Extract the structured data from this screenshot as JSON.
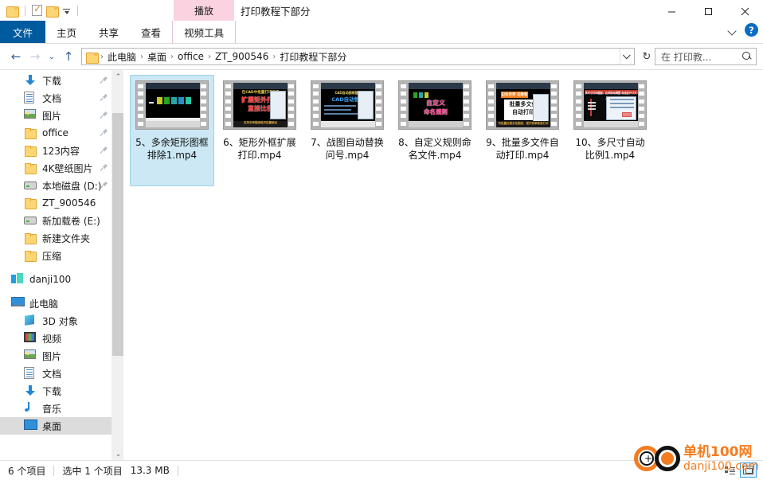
{
  "window": {
    "title": "打印教程下部分",
    "quick_access": [
      {
        "name": "folder-icon",
        "label": ""
      },
      {
        "name": "properties-icon",
        "label": ""
      },
      {
        "name": "new-folder-icon",
        "label": ""
      }
    ],
    "controls": {
      "minimize": "minimize-icon",
      "maximize": "maximize-icon",
      "close": "close-icon"
    }
  },
  "ribbon": {
    "contextual_group": "视频工具",
    "contextual_tab": "播放",
    "tabs": [
      {
        "label": "文件",
        "active": true
      },
      {
        "label": "主页",
        "active": false
      },
      {
        "label": "共享",
        "active": false
      },
      {
        "label": "查看",
        "active": false
      }
    ],
    "collapse_icon": "chevron-down-icon",
    "help_label": "?"
  },
  "address": {
    "back_icon": "back-arrow-icon",
    "forward_icon": "forward-arrow-icon",
    "recent_icon": "recent-locations-icon",
    "up_icon": "up-arrow-icon",
    "crumbs": [
      "此电脑",
      "桌面",
      "office",
      "ZT_900546",
      "打印教程下部分"
    ],
    "separator": "›",
    "dropdown_icon": "chevron-down-icon",
    "refresh_icon": "refresh-icon",
    "refresh_glyph": "↻"
  },
  "search": {
    "placeholder": "在 打印教...",
    "icon": "search-icon"
  },
  "sidebar": {
    "items": [
      {
        "label": "下载",
        "icon": "download-icon",
        "pinned": true,
        "indent": 1,
        "selected": false
      },
      {
        "label": "文档",
        "icon": "document-icon",
        "pinned": true,
        "indent": 1,
        "selected": false
      },
      {
        "label": "图片",
        "icon": "pictures-icon",
        "pinned": true,
        "indent": 1,
        "selected": false
      },
      {
        "label": "office",
        "icon": "folder-icon",
        "pinned": true,
        "indent": 1,
        "selected": false
      },
      {
        "label": "123内容",
        "icon": "folder-icon",
        "pinned": true,
        "indent": 1,
        "selected": false
      },
      {
        "label": "4K壁纸图片",
        "icon": "folder-icon",
        "pinned": true,
        "indent": 1,
        "selected": false
      },
      {
        "label": "本地磁盘 (D:)",
        "icon": "drive-icon",
        "pinned": true,
        "indent": 1,
        "selected": false
      },
      {
        "label": "ZT_900546",
        "icon": "folder-icon",
        "pinned": false,
        "indent": 1,
        "selected": false
      },
      {
        "label": "新加载卷 (E:)",
        "icon": "drive-icon",
        "pinned": false,
        "indent": 1,
        "selected": false
      },
      {
        "label": "新建文件夹",
        "icon": "folder-icon",
        "pinned": false,
        "indent": 1,
        "selected": false
      },
      {
        "label": "压缩",
        "icon": "folder-icon",
        "pinned": false,
        "indent": 1,
        "selected": false
      },
      {
        "label": "danji100",
        "icon": "cloud-icon",
        "pinned": false,
        "indent": 0,
        "selected": false,
        "gap_before": true
      },
      {
        "label": "此电脑",
        "icon": "this-pc-icon",
        "pinned": false,
        "indent": 0,
        "selected": false,
        "gap_before": true
      },
      {
        "label": "3D 对象",
        "icon": "3d-objects-icon",
        "pinned": false,
        "indent": 1,
        "selected": false
      },
      {
        "label": "视频",
        "icon": "videos-icon",
        "pinned": false,
        "indent": 1,
        "selected": false
      },
      {
        "label": "图片",
        "icon": "pictures-icon",
        "pinned": false,
        "indent": 1,
        "selected": false
      },
      {
        "label": "文档",
        "icon": "document-icon",
        "pinned": false,
        "indent": 1,
        "selected": false
      },
      {
        "label": "下载",
        "icon": "download-icon",
        "pinned": false,
        "indent": 1,
        "selected": false
      },
      {
        "label": "音乐",
        "icon": "music-icon",
        "pinned": false,
        "indent": 1,
        "selected": false
      },
      {
        "label": "桌面",
        "icon": "desktop-icon",
        "pinned": false,
        "indent": 1,
        "selected": true
      }
    ],
    "scroll_up_glyph": "⌃",
    "scroll_down_glyph": "⌄"
  },
  "files": {
    "items": [
      {
        "name": "5、多余矩形图框排除1.mp4",
        "selected": true,
        "thumb": {
          "style": "cad-dark",
          "text1": "",
          "text2": "",
          "text1_color": "#f2f2f2",
          "text2_color": "#f2f2f2"
        }
      },
      {
        "name": "6、矩形外框扩展打印.mp4",
        "selected": false,
        "thumb": {
          "style": "cad-red",
          "text1": "扩展矩外打印",
          "text2": "直接比例",
          "text1_color": "#ff2b2b",
          "text2_color": "#ff2b2b"
        }
      },
      {
        "name": "7、战图自动替换问号.mp4",
        "selected": false,
        "thumb": {
          "style": "cad-blue",
          "text1": "CAD自动图框替换",
          "text2": "",
          "text1_color": "#3ea7ff",
          "text2_color": "#ffffff"
        }
      },
      {
        "name": "8、自定义规则命名文件.mp4",
        "selected": false,
        "thumb": {
          "style": "cad-pink",
          "text1": "自定义",
          "text2": "命名规则",
          "text1_color": "#ff3d8b",
          "text2_color": "#ff3d8b"
        }
      },
      {
        "name": "9、批量多文件自动打印.mp4",
        "selected": false,
        "thumb": {
          "style": "cad-orange",
          "text1": "批量多文件",
          "text2": "自动打印",
          "text1_color": "#222222",
          "text2_color": "#222222"
        }
      },
      {
        "name": "10、多尺寸自动比例1.mp4",
        "selected": false,
        "thumb": {
          "style": "cad-panel",
          "text1": "",
          "text2": "",
          "text1_color": "#ffffff",
          "text2_color": "#ffffff"
        }
      }
    ]
  },
  "status": {
    "item_count": "6 个项目",
    "selection": "选中 1 个项目",
    "size": "13.3 MB",
    "view_details_icon": "details-view-icon",
    "view_large_icons_icon": "large-icons-view-icon"
  },
  "watermark": {
    "cn": "单机100网",
    "en": "danji100.com"
  },
  "colors": {
    "accent": "#005a9e",
    "selection": "#cce8f4",
    "contextual": "#fbd3e0",
    "watermark": "#f47c20"
  }
}
